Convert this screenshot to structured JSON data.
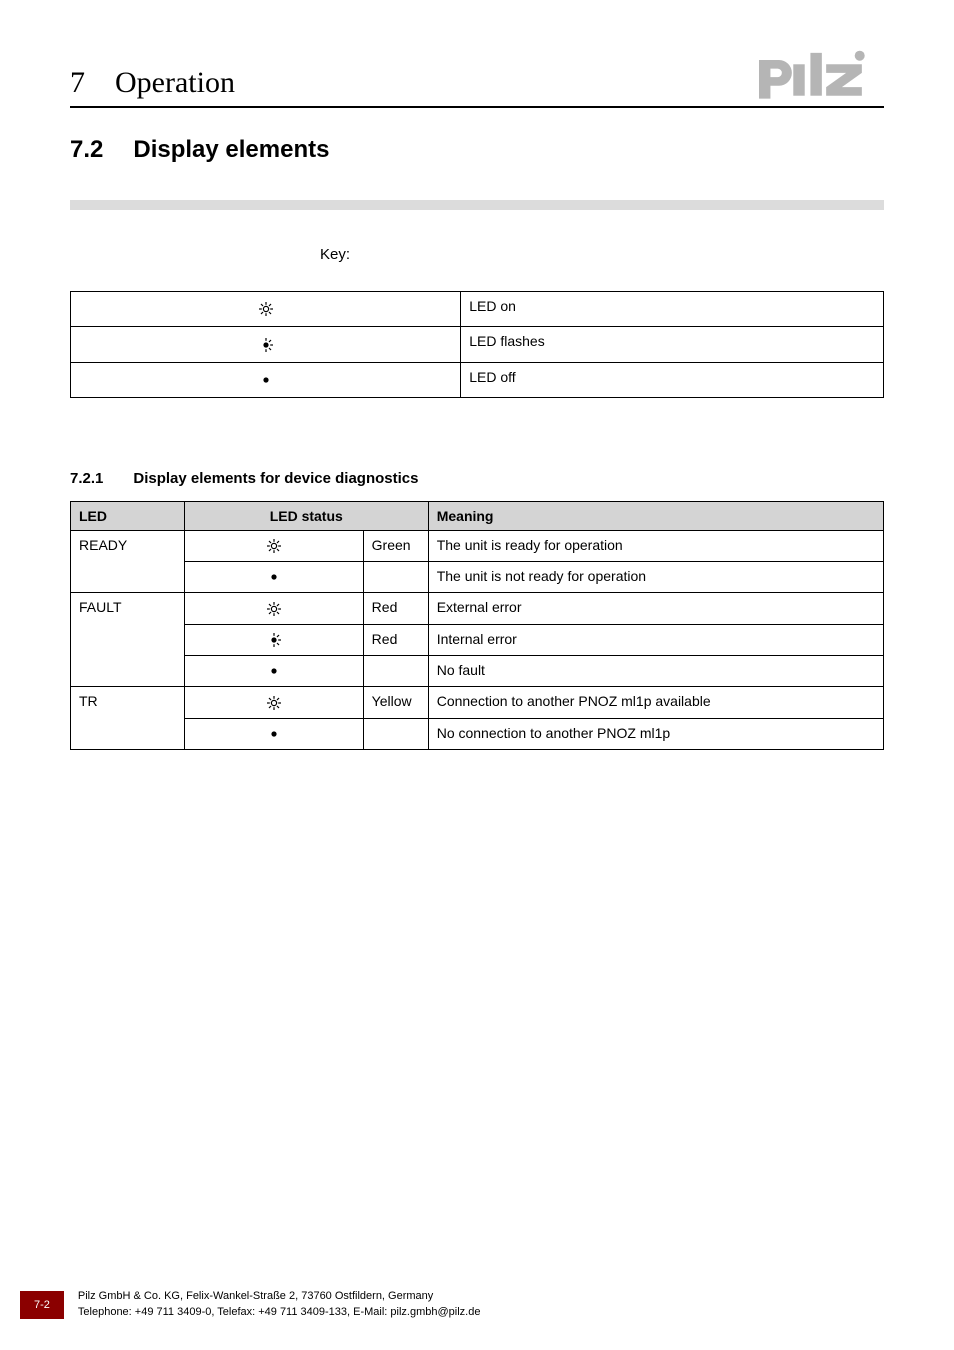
{
  "chapter": {
    "num": "7",
    "title": "Operation"
  },
  "section": {
    "num": "7.2",
    "title": "Display elements"
  },
  "key": {
    "label": "Key:",
    "rows": [
      {
        "icon": "led-on",
        "desc": "LED on"
      },
      {
        "icon": "led-flash",
        "desc": "LED flashes"
      },
      {
        "icon": "led-off",
        "desc": "LED off"
      }
    ]
  },
  "subsection": {
    "num": "7.2.1",
    "title": "Display elements for device diagnostics"
  },
  "diag": {
    "headers": {
      "led": "LED",
      "status": "LED status",
      "meaning": "Meaning"
    },
    "rows": [
      {
        "led": "READY",
        "icon": "led-on",
        "color": "Green",
        "meaning": "The unit is ready for operation"
      },
      {
        "led": "",
        "icon": "led-off",
        "color": "",
        "meaning": "The unit is not ready for operation"
      },
      {
        "led": "FAULT",
        "icon": "led-on",
        "color": "Red",
        "meaning": "External error"
      },
      {
        "led": "",
        "icon": "led-flash",
        "color": "Red",
        "meaning": "Internal error"
      },
      {
        "led": "",
        "icon": "led-off",
        "color": "",
        "meaning": "No fault"
      },
      {
        "led": "TR",
        "icon": "led-on",
        "color": "Yellow",
        "meaning": "Connection to another PNOZ ml1p available"
      },
      {
        "led": "",
        "icon": "led-off",
        "color": "",
        "meaning": "No connection to another PNOZ ml1p"
      }
    ]
  },
  "footer": {
    "page": "7-2",
    "line1": "Pilz GmbH & Co. KG, Felix-Wankel-Straße 2, 73760 Ostfildern, Germany",
    "line2": "Telephone: +49 711 3409-0, Telefax: +49 711 3409-133, E-Mail: pilz.gmbh@pilz.de"
  }
}
